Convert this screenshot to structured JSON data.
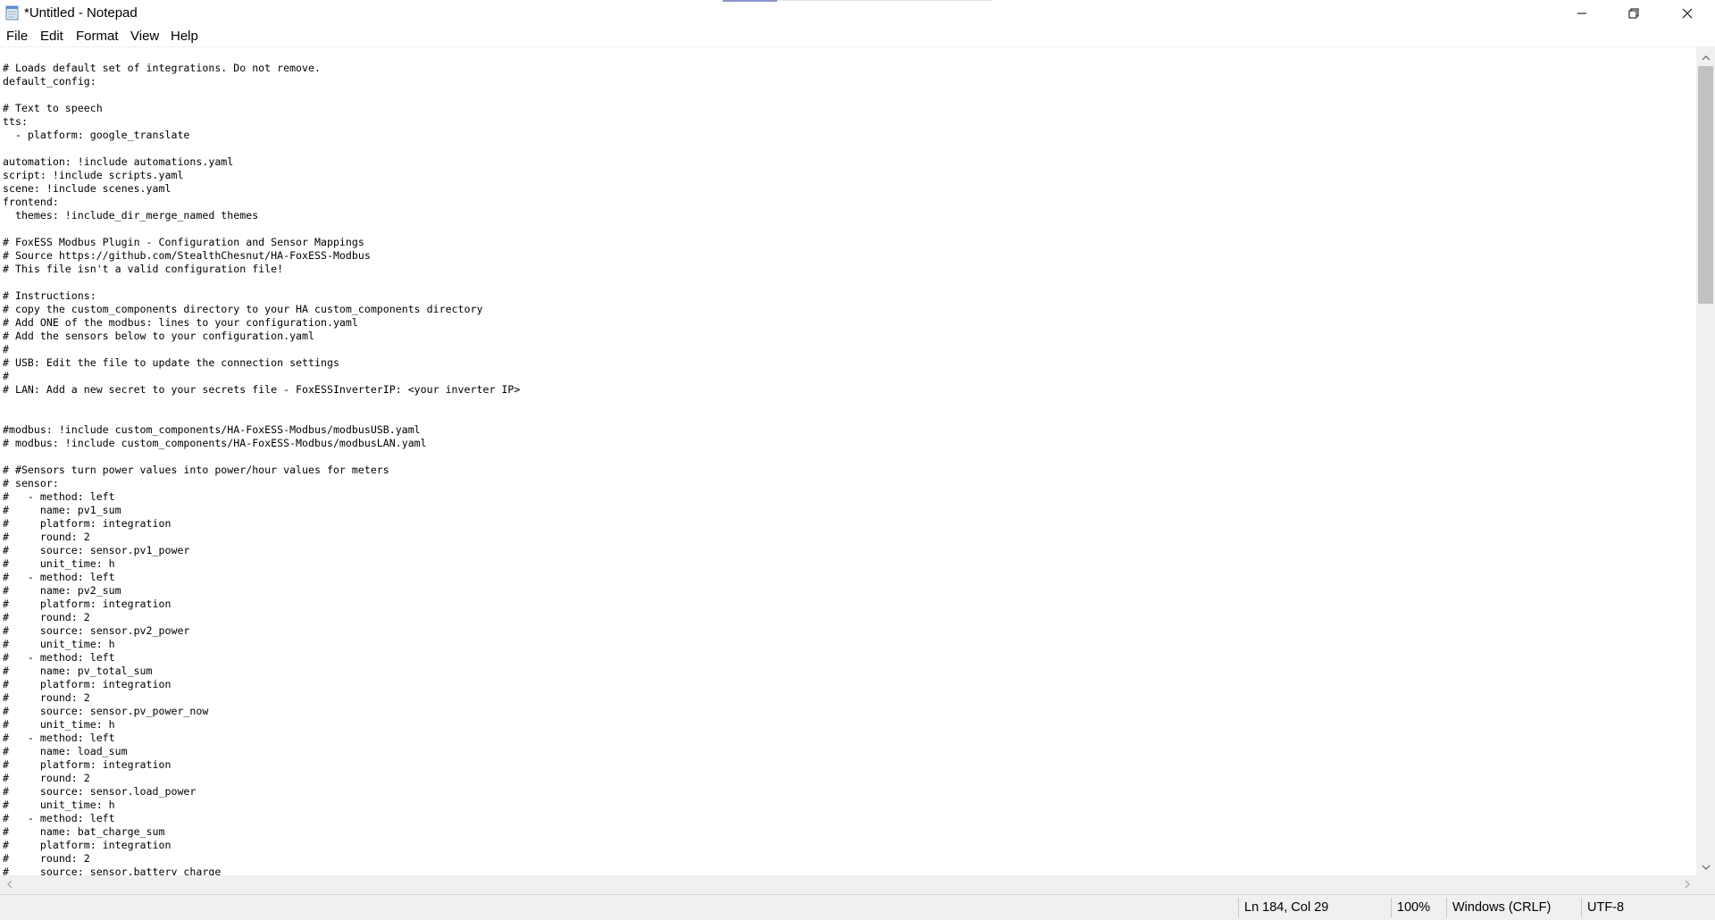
{
  "window": {
    "title": "*Untitled - Notepad",
    "icons": [
      "notepad-icon",
      "minimize-icon",
      "maximize-icon",
      "close-icon"
    ]
  },
  "menu": {
    "file": "File",
    "edit": "Edit",
    "format": "Format",
    "view": "View",
    "help": "Help"
  },
  "editor": {
    "lines": [
      "# Loads default set of integrations. Do not remove.",
      "default_config:",
      "",
      "# Text to speech",
      "tts:",
      "  - platform: google_translate",
      "",
      "automation: !include automations.yaml",
      "script: !include scripts.yaml",
      "scene: !include scenes.yaml",
      "frontend:",
      "  themes: !include_dir_merge_named themes",
      "",
      "# FoxESS Modbus Plugin - Configuration and Sensor Mappings",
      "# Source https://github.com/StealthChesnut/HA-FoxESS-Modbus",
      "# This file isn't a valid configuration file!",
      "",
      "# Instructions:",
      "# copy the custom_components directory to your HA custom_components directory",
      "# Add ONE of the modbus: lines to your configuration.yaml",
      "# Add the sensors below to your configuration.yaml",
      "#",
      "# USB: Edit the file to update the connection settings",
      "#",
      "# LAN: Add a new secret to your secrets file - FoxESSInverterIP: <your inverter IP>",
      "",
      "",
      "#modbus: !include custom_components/HA-FoxESS-Modbus/modbusUSB.yaml",
      "# modbus: !include custom_components/HA-FoxESS-Modbus/modbusLAN.yaml",
      "",
      "# #Sensors turn power values into power/hour values for meters",
      "# sensor:",
      "#   - method: left",
      "#     name: pv1_sum",
      "#     platform: integration",
      "#     round: 2",
      "#     source: sensor.pv1_power",
      "#     unit_time: h",
      "#   - method: left",
      "#     name: pv2_sum",
      "#     platform: integration",
      "#     round: 2",
      "#     source: sensor.pv2_power",
      "#     unit_time: h",
      "#   - method: left",
      "#     name: pv_total_sum",
      "#     platform: integration",
      "#     round: 2",
      "#     source: sensor.pv_power_now",
      "#     unit_time: h",
      "#   - method: left",
      "#     name: load_sum",
      "#     platform: integration",
      "#     round: 2",
      "#     source: sensor.load_power",
      "#     unit_time: h",
      "#   - method: left",
      "#     name: bat_charge_sum",
      "#     platform: integration",
      "#     round: 2",
      "#     source: sensor.battery_charge"
    ]
  },
  "status": {
    "position": "Ln 184, Col 29",
    "zoom": "100%",
    "line_ending": "Windows (CRLF)",
    "encoding": "UTF-8"
  }
}
